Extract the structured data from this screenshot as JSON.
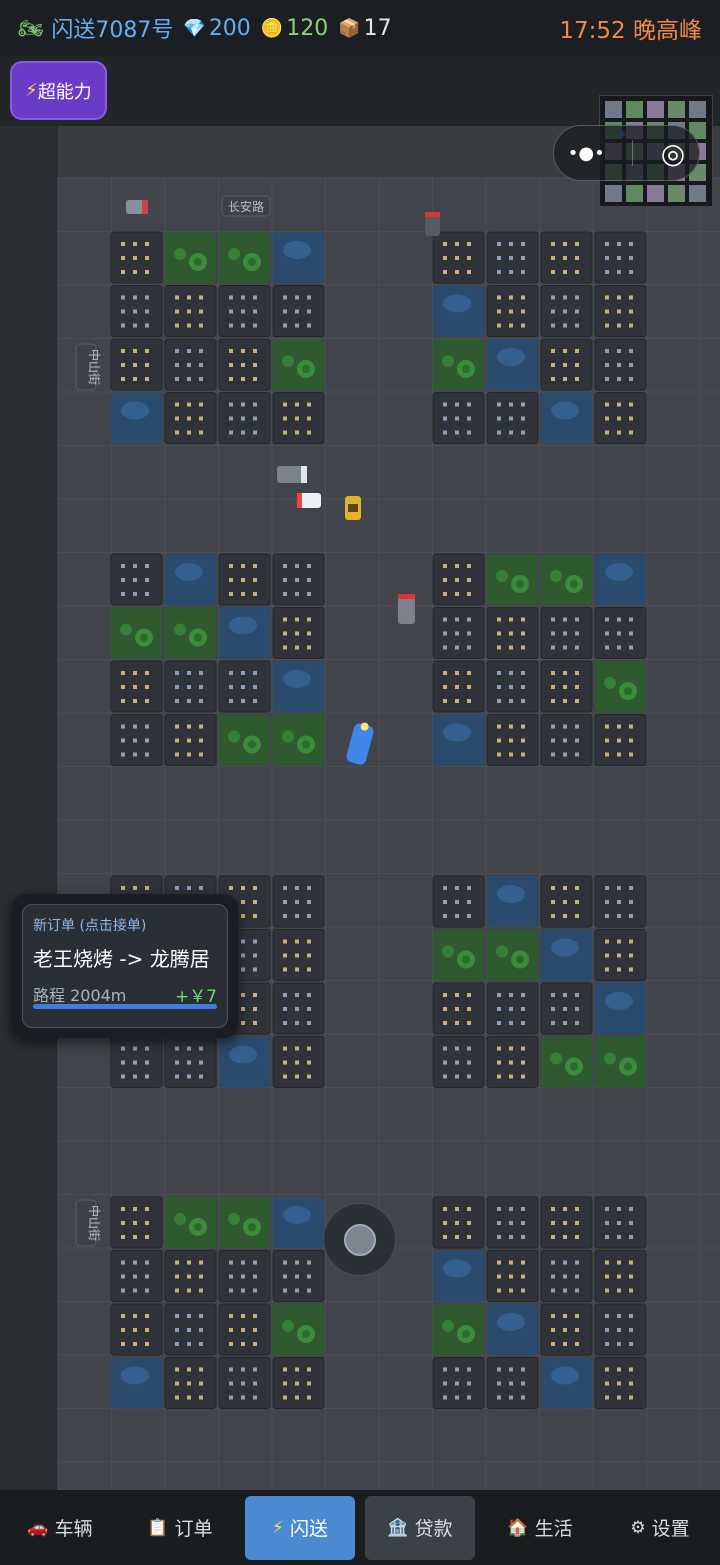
{
  "header": {
    "rider_icon": "motorbike-icon",
    "rider_name": "闪送7087号",
    "diamonds": "200",
    "coins": "120",
    "packages": "17",
    "time_status": "17:52 晚高峰"
  },
  "power_button": {
    "icon": "lightning-icon",
    "label": "超能力"
  },
  "capsule": {
    "more": "•●•",
    "target": "◎"
  },
  "map": {
    "road_labels": [
      "长安路",
      "中山街",
      "中山街"
    ],
    "player_color": "#3f86e8"
  },
  "order_card": {
    "title": "新订单 (点击接单)",
    "route": "老王烧烤 -> 龙腾居",
    "distance": "路程 2004m",
    "reward": "+￥7"
  },
  "nav": [
    {
      "icon": "car-icon",
      "glyph": "🚗",
      "label": "车辆"
    },
    {
      "icon": "clipboard-icon",
      "glyph": "📋",
      "label": "订单"
    },
    {
      "icon": "lightning-icon",
      "glyph": "⚡",
      "label": "闪送"
    },
    {
      "icon": "bank-icon",
      "glyph": "🏦",
      "label": "贷款"
    },
    {
      "icon": "house-icon",
      "glyph": "🏠",
      "label": "生活"
    },
    {
      "icon": "gear-icon",
      "glyph": "⚙",
      "label": "设置"
    }
  ]
}
